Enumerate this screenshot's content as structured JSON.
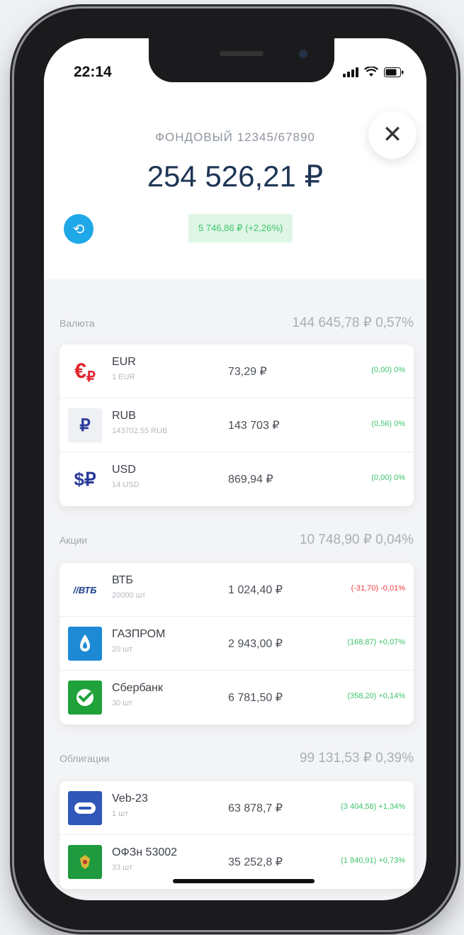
{
  "status": {
    "time": "22:14"
  },
  "header": {
    "account_name": "ФОНДОВЫЙ 12345/67890",
    "total_value": "254 526,21 ₽",
    "change": "5 746,86 ₽ (+2,26%)",
    "close_icon": "close-icon",
    "history_icon": "history-icon"
  },
  "colors": {
    "accent": "#1fa8e8",
    "positive": "#3cc46a",
    "negative": "#ef3b42",
    "title": "#1e3555"
  },
  "sections": [
    {
      "title": "Валюта",
      "summary": "144 645,78 ₽  0,57%",
      "items": [
        {
          "name": "EUR",
          "sub": "1 EUR",
          "price": "73,29 ₽",
          "change": "(0,00) 0%",
          "icon": "euro-rub-icon"
        },
        {
          "name": "RUB",
          "sub": "143702.55 RUB",
          "price": "143 703 ₽",
          "change": "(0,56) 0%",
          "icon": "rub-icon"
        },
        {
          "name": "USD",
          "sub": "14 USD",
          "price": "869,94 ₽",
          "change": "(0,00) 0%",
          "icon": "usd-rub-icon"
        }
      ]
    },
    {
      "title": "Акции",
      "summary": "10 748,90 ₽  0,04%",
      "items": [
        {
          "name": "ВТБ",
          "sub": "20000 шт",
          "price": "1 024,40 ₽",
          "change": "(-31,70) -0,01%",
          "icon": "vtb-logo-icon"
        },
        {
          "name": "ГАЗПРОМ",
          "sub": "20 шт",
          "price": "2 943,00 ₽",
          "change": "(168,87) +0,07%",
          "icon": "gazprom-logo-icon"
        },
        {
          "name": "Сбербанк",
          "sub": "30 шт",
          "price": "6 781,50 ₽",
          "change": "(358,20) +0,14%",
          "icon": "sberbank-logo-icon"
        }
      ]
    },
    {
      "title": "Облигации",
      "summary": "99 131,53 ₽  0,39%",
      "items": [
        {
          "name": "Veb-23",
          "sub": "1 шт",
          "price": "63 878,7 ₽",
          "change": "(3 404,58) +1,34%",
          "icon": "veb-logo-icon"
        },
        {
          "name": "ОФЗн 53002",
          "sub": "33 шт",
          "price": "35 252,8 ₽",
          "change": "(1 840,91) +0,73%",
          "icon": "ofz-emblem-icon"
        }
      ]
    }
  ]
}
